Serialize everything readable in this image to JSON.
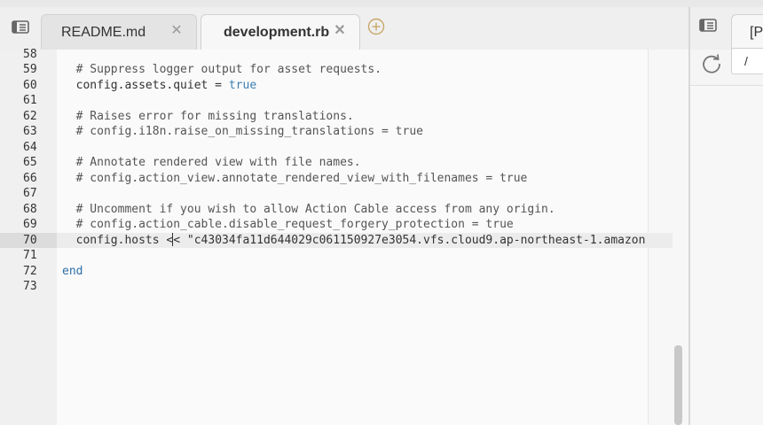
{
  "editor_tabs": [
    {
      "label": "README.md",
      "close": "✕",
      "active": false
    },
    {
      "label": "development.rb",
      "close": "✕",
      "active": true
    }
  ],
  "icons": {
    "tab_menu": "tab-menu-icon",
    "add_tab": "plus-circle-icon",
    "refresh": "refresh-icon",
    "close": "close-icon"
  },
  "code_lines": [
    {
      "num": "58",
      "text": "",
      "type": "plain"
    },
    {
      "num": "59",
      "text": "  # Suppress logger output for asset requests.",
      "type": "comment"
    },
    {
      "num": "60",
      "prefix": "  config.assets.quiet = ",
      "value": "true",
      "type": "assign"
    },
    {
      "num": "61",
      "text": "",
      "type": "plain"
    },
    {
      "num": "62",
      "text": "  # Raises error for missing translations.",
      "type": "comment"
    },
    {
      "num": "63",
      "text": "  # config.i18n.raise_on_missing_translations = true",
      "type": "comment"
    },
    {
      "num": "64",
      "text": "",
      "type": "plain"
    },
    {
      "num": "65",
      "text": "  # Annotate rendered view with file names.",
      "type": "comment"
    },
    {
      "num": "66",
      "text": "  # config.action_view.annotate_rendered_view_with_filenames = true",
      "type": "comment"
    },
    {
      "num": "67",
      "text": "",
      "type": "plain"
    },
    {
      "num": "68",
      "text": "  # Uncomment if you wish to allow Action Cable access from any origin.",
      "type": "comment"
    },
    {
      "num": "69",
      "text": "  # config.action_cable.disable_request_forgery_protection = true",
      "type": "comment"
    },
    {
      "num": "70",
      "before_cursor": "  config.hosts <",
      "after_cursor": "< \"c43034fa11d644029c061150927e3054.vfs.cloud9.ap-northeast-1.amazon",
      "type": "cursor"
    },
    {
      "num": "71",
      "text": "",
      "type": "plain"
    },
    {
      "num": "72",
      "text": "end",
      "type": "end"
    },
    {
      "num": "73",
      "text": "",
      "type": "plain"
    }
  ],
  "active_line": "70",
  "right_pane": {
    "tab_label": "[P",
    "url_value": "/"
  }
}
